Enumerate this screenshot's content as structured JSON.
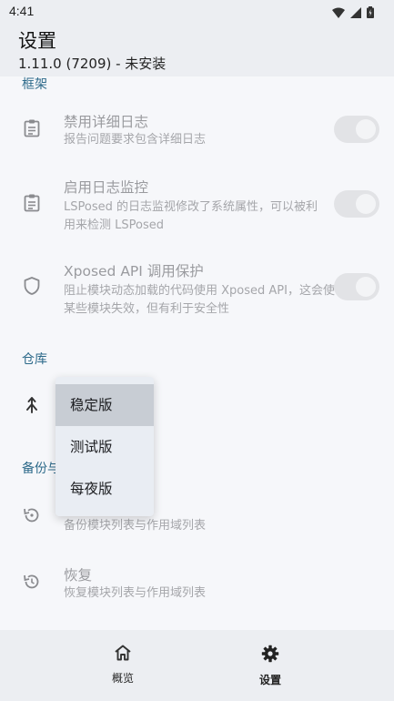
{
  "status_bar": {
    "time": "4:41",
    "icons": [
      "wifi-icon",
      "signal-icon",
      "battery-icon"
    ]
  },
  "app_bar": {
    "title": "设置",
    "subtitle": "1.11.0 (7209) - 未安装"
  },
  "sections": {
    "framework": {
      "title": "框架",
      "items": [
        {
          "primary": "禁用详细日志",
          "secondary": "报告问题要求包含详细日志",
          "icon": "document-icon",
          "switch_on": true
        },
        {
          "primary": "启用日志监控",
          "secondary": "LSPosed 的日志监视修改了系统属性，可以被利用来检测 LSPosed",
          "icon": "document-icon",
          "switch_on": true
        },
        {
          "primary": "Xposed API 调用保护",
          "secondary": "阻止模块动态加载的代码使用 Xposed API，这会使某些模块失效，但有利于安全性",
          "icon": "shield-icon",
          "switch_on": true
        }
      ]
    },
    "repo": {
      "title": "仓库",
      "icon": "merge-icon"
    },
    "backup": {
      "title": "备份与",
      "items": [
        {
          "secondary": "备份模块列表与作用域列表",
          "icon": "backup-icon"
        },
        {
          "primary": "恢复",
          "secondary": "恢复模块列表与作用域列表",
          "icon": "restore-icon"
        }
      ]
    }
  },
  "dropdown": {
    "options": [
      "稳定版",
      "测试版",
      "每夜版"
    ],
    "selected": "稳定版"
  },
  "bottom_nav": [
    {
      "label": "概览",
      "icon": "home-icon",
      "active": false
    },
    {
      "label": "设置",
      "icon": "gear-icon",
      "active": true
    }
  ],
  "colors": {
    "section_title": "#2d6a8a",
    "background": "#f6f7fa",
    "bar": "#eceef2"
  }
}
